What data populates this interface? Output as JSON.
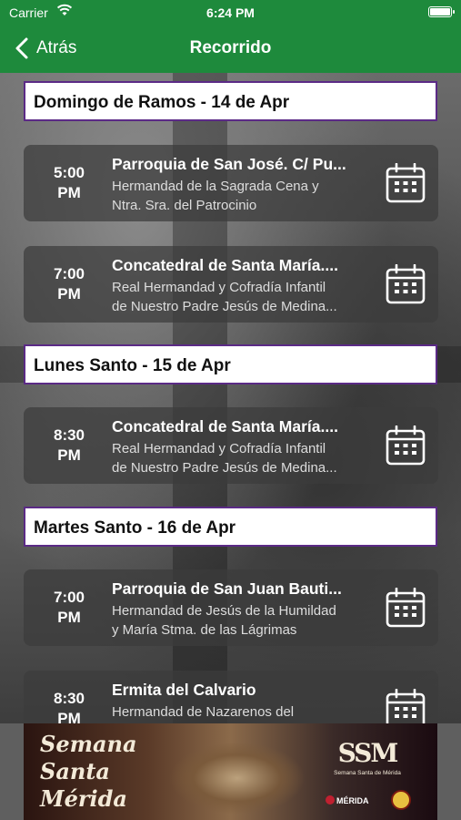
{
  "status_bar": {
    "carrier": "Carrier",
    "time": "6:24 PM"
  },
  "nav": {
    "back_label": "Atrás",
    "title": "Recorrido"
  },
  "sections": [
    {
      "header": "Domingo de Ramos - 14 de Apr",
      "events": [
        {
          "time_hm": "5:00",
          "time_ampm": "PM",
          "title": "Parroquia de San José. C/ Pu...",
          "sub1": "Hermandad de la Sagrada Cena y",
          "sub2": "Ntra. Sra. del Patrocinio"
        },
        {
          "time_hm": "7:00",
          "time_ampm": "PM",
          "title": "Concatedral de Santa María....",
          "sub1": "Real Hermandad y Cofradía Infantil",
          "sub2": "de Nuestro Padre Jesús de Medina..."
        }
      ]
    },
    {
      "header": "Lunes Santo - 15 de Apr",
      "events": [
        {
          "time_hm": "8:30",
          "time_ampm": "PM",
          "title": "Concatedral de Santa María....",
          "sub1": "Real Hermandad y Cofradía Infantil",
          "sub2": "de Nuestro Padre Jesús de Medina..."
        }
      ]
    },
    {
      "header": "Martes Santo - 16 de Apr",
      "events": [
        {
          "time_hm": "7:00",
          "time_ampm": "PM",
          "title": "Parroquia de San Juan Bauti...",
          "sub1": "Hermandad de Jesús de la Humildad",
          "sub2": "y María Stma. de las Lágrimas"
        },
        {
          "time_hm": "8:30",
          "time_ampm": "PM",
          "title": "Ermita del Calvario",
          "sub1": "Hermandad de Nazarenos del",
          "sub2": ""
        }
      ]
    }
  ],
  "banner": {
    "line1": "Semana",
    "line2": "Santa",
    "line3": "Mérida",
    "logo_mark": "SSM",
    "logo_tag": "Semana Santa de Mérida",
    "brand": "MÉRIDA"
  },
  "colors": {
    "nav_green": "#1e8a3c",
    "header_border": "#5b2a86"
  },
  "icons": {
    "calendar": "calendar-icon",
    "back": "chevron-left-icon",
    "wifi": "wifi-icon",
    "battery": "battery-icon"
  }
}
